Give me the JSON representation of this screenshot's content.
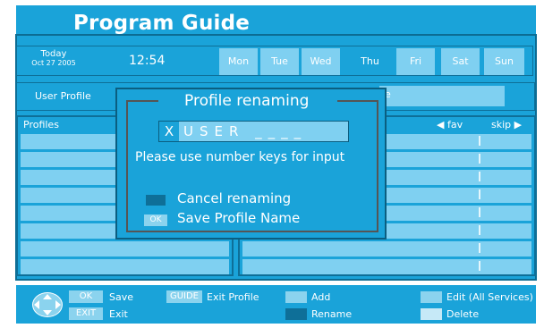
{
  "header": {
    "title": "Program Guide"
  },
  "datebar": {
    "today_label": "Today",
    "today_date": "Oct 27 2005",
    "time": "12:54",
    "days": [
      {
        "label": "Mon"
      },
      {
        "label": "Tue"
      },
      {
        "label": "Wed"
      },
      {
        "label": "Thu",
        "active": true
      },
      {
        "label": "Fri"
      },
      {
        "label": "Sat"
      },
      {
        "label": "Sun"
      }
    ]
  },
  "profile": {
    "label": "User Profile",
    "value": "e"
  },
  "left_panel": {
    "header": "Profiles"
  },
  "right_panel": {
    "fav": "◀ fav",
    "skip": "skip ▶"
  },
  "dialog": {
    "title": "Profile renaming",
    "name_first": "X",
    "name_rest": "USER ____",
    "hint": "Please use number keys for input",
    "cancel_label": "Cancel renaming",
    "ok_key": "OK",
    "save_label": "Save Profile Name"
  },
  "footer": {
    "ok_key": "OK",
    "ok_label": "Save",
    "exit_key": "EXIT",
    "exit_label": "Exit",
    "guide_key": "GUIDE",
    "guide_label": "Exit Profile",
    "add_label": "Add",
    "rename_label": "Rename",
    "edit_label": "Edit (All Services)",
    "delete_label": "Delete"
  },
  "colors": {
    "panel": "#1aa3d9",
    "light": "#7fd0f1",
    "dark": "#0e6f98"
  }
}
